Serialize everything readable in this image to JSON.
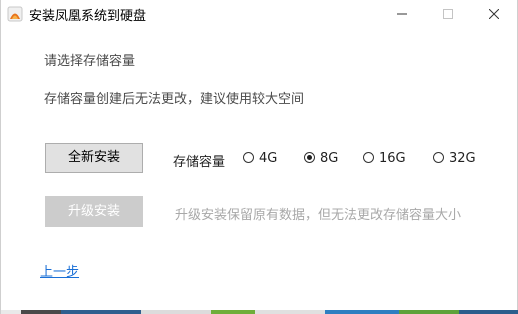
{
  "window": {
    "title": "安装凤凰系统到硬盘",
    "controls": {
      "minimize": "minimize-icon",
      "maximize": "maximize-icon",
      "close": "close-icon"
    }
  },
  "main": {
    "heading": "请选择存储容量",
    "note": "存储容量创建后无法更改，建议使用较大空间",
    "fresh_install_label": "全新安装",
    "upgrade_install_label": "升级安装",
    "upgrade_hint": "升级安装保留原有数据，但无法更改存储容量大小",
    "capacity_label": "存储容量",
    "capacity_options": [
      "4G",
      "8G",
      "16G",
      "32G"
    ],
    "selected_capacity": "8G",
    "back_link": "上一步"
  },
  "colors": {
    "link": "#1a6fd6",
    "disabled_button": "#cccccc",
    "button": "#e1e1e1",
    "hint_text": "#a8a8a8"
  }
}
